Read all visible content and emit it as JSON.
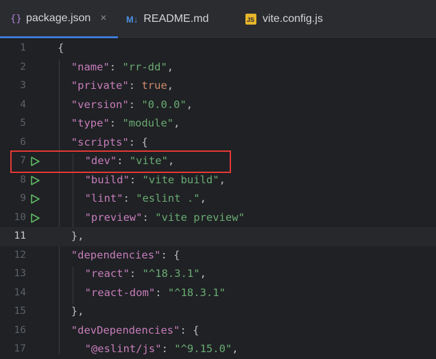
{
  "tabs": [
    {
      "label": "package.json",
      "icon": "braces-icon",
      "active": true,
      "close": "×"
    },
    {
      "label": "README.md",
      "icon": "markdown-icon",
      "badge": "M↓",
      "active": false
    },
    {
      "label": "vite.config.js",
      "icon": "js-file-icon",
      "badge": "JS",
      "active": false
    }
  ],
  "lines": [
    {
      "num": "1",
      "parts": [
        [
          "p",
          "{"
        ]
      ]
    },
    {
      "num": "2",
      "parts": [
        [
          "k",
          "\"name\""
        ],
        [
          "p",
          ": "
        ],
        [
          "s",
          "\"rr-dd\""
        ],
        [
          "p",
          ","
        ]
      ]
    },
    {
      "num": "3",
      "parts": [
        [
          "k",
          "\"private\""
        ],
        [
          "p",
          ": "
        ],
        [
          "b",
          "true"
        ],
        [
          "p",
          ","
        ]
      ]
    },
    {
      "num": "4",
      "parts": [
        [
          "k",
          "\"version\""
        ],
        [
          "p",
          ": "
        ],
        [
          "s",
          "\"0.0.0\""
        ],
        [
          "p",
          ","
        ]
      ]
    },
    {
      "num": "5",
      "parts": [
        [
          "k",
          "\"type\""
        ],
        [
          "p",
          ": "
        ],
        [
          "s",
          "\"module\""
        ],
        [
          "p",
          ","
        ]
      ]
    },
    {
      "num": "6",
      "parts": [
        [
          "k",
          "\"scripts\""
        ],
        [
          "p",
          ": {"
        ]
      ]
    },
    {
      "num": "7",
      "run": true,
      "parts": [
        [
          "k",
          "\"dev\""
        ],
        [
          "p",
          ": "
        ],
        [
          "s",
          "\"vite\""
        ],
        [
          "p",
          ","
        ]
      ]
    },
    {
      "num": "8",
      "run": true,
      "parts": [
        [
          "k",
          "\"build\""
        ],
        [
          "p",
          ": "
        ],
        [
          "s",
          "\"vite build\""
        ],
        [
          "p",
          ","
        ]
      ]
    },
    {
      "num": "9",
      "run": true,
      "parts": [
        [
          "k",
          "\"lint\""
        ],
        [
          "p",
          ": "
        ],
        [
          "s",
          "\"eslint .\""
        ],
        [
          "p",
          ","
        ]
      ]
    },
    {
      "num": "10",
      "run": true,
      "parts": [
        [
          "k",
          "\"preview\""
        ],
        [
          "p",
          ": "
        ],
        [
          "s",
          "\"vite preview\""
        ]
      ]
    },
    {
      "num": "11",
      "current": true,
      "parts": [
        [
          "p",
          "},"
        ]
      ]
    },
    {
      "num": "12",
      "parts": [
        [
          "k",
          "\"dependencies\""
        ],
        [
          "p",
          ": {"
        ]
      ]
    },
    {
      "num": "13",
      "parts": [
        [
          "k",
          "\"react\""
        ],
        [
          "p",
          ": "
        ],
        [
          "s",
          "\"^18.3.1\""
        ],
        [
          "p",
          ","
        ]
      ]
    },
    {
      "num": "14",
      "parts": [
        [
          "k",
          "\"react-dom\""
        ],
        [
          "p",
          ": "
        ],
        [
          "s",
          "\"^18.3.1\""
        ]
      ]
    },
    {
      "num": "15",
      "parts": [
        [
          "p",
          "},"
        ]
      ]
    },
    {
      "num": "16",
      "parts": [
        [
          "k",
          "\"devDependencies\""
        ],
        [
          "p",
          ": {"
        ]
      ]
    },
    {
      "num": "17",
      "parts": [
        [
          "k",
          "\"@eslint/js\""
        ],
        [
          "p",
          ": "
        ],
        [
          "s",
          "\"^9.15.0\""
        ],
        [
          "p",
          ","
        ]
      ]
    }
  ],
  "colors": {
    "key": "#c77dbb",
    "string": "#6aab73",
    "boolean": "#cf8e6d",
    "punct": "#bcbec4",
    "run_green": "#5fb865",
    "highlight_red": "#e53935",
    "tab_underline": "#3d7bd6"
  }
}
